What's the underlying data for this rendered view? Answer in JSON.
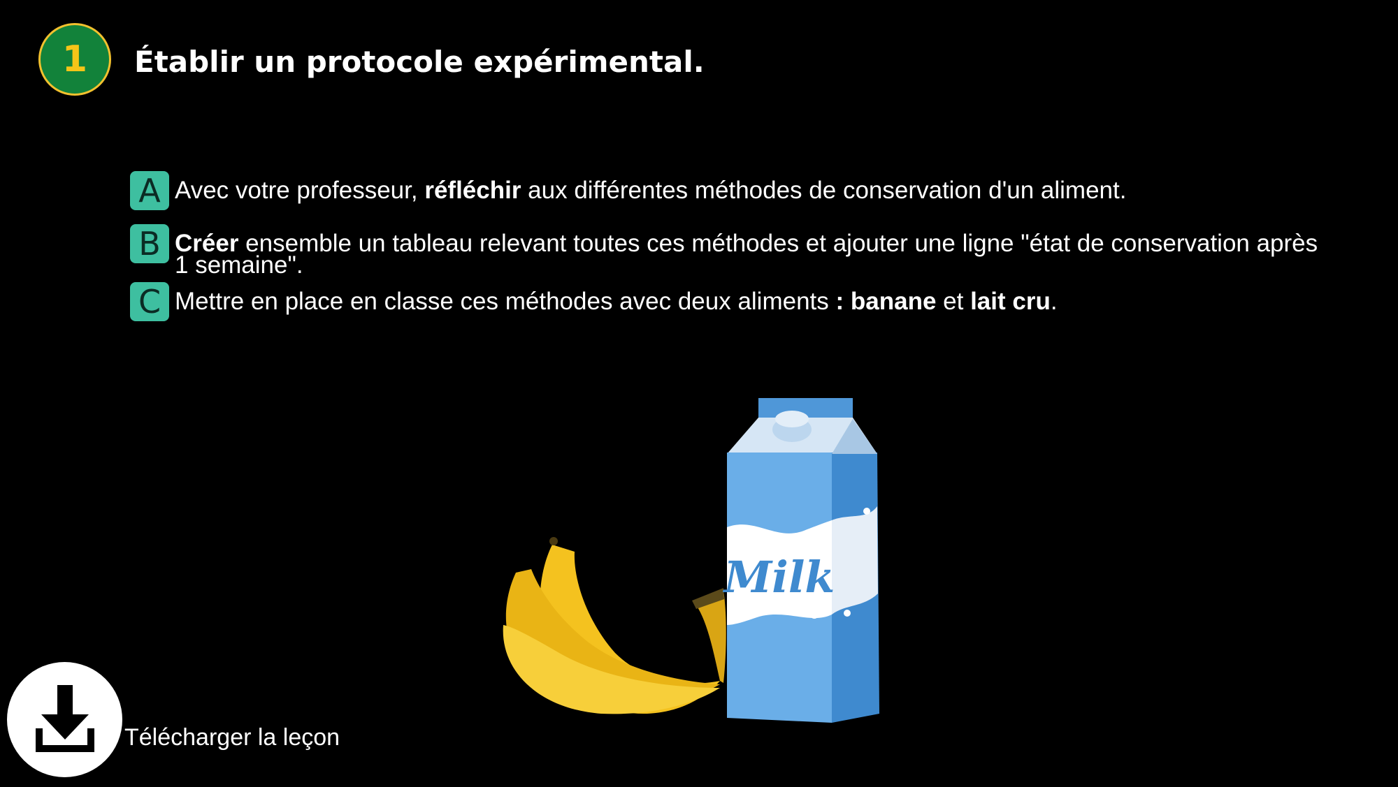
{
  "header": {
    "step_number": "1",
    "title": "Établir un protocole expérimental."
  },
  "instructions": {
    "a": {
      "letter": "A",
      "t1": "Avec votre professeur, ",
      "b1": "réfléchir",
      "t2": " aux différentes méthodes de conservation d'un aliment."
    },
    "b": {
      "letter": "B",
      "b1": "Créer",
      "t1": " ensemble un tableau relevant toutes ces méthodes et ajouter une ligne \"état de conservation après 1 semaine\"."
    },
    "c": {
      "letter": "C",
      "t1": "Mettre en place en classe ces méthodes avec deux aliments ",
      "b1": ": banane",
      "t2": " et ",
      "b2": "lait cru",
      "t3": "."
    }
  },
  "illustration": {
    "carton_label": "Milk",
    "carton_color": "#6aaee8",
    "banana_color": "#f4c21f"
  },
  "footer": {
    "download_label": "Télécharger la leçon",
    "download_icon": "download-icon"
  }
}
